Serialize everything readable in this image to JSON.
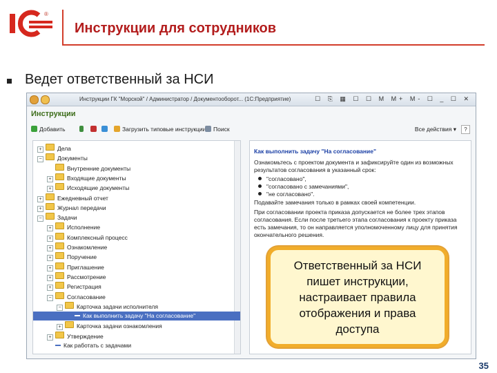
{
  "header": {
    "title": "Инструкции для сотрудников",
    "logo_reg": "®"
  },
  "slide": {
    "bullet_text": "Ведет ответственный за НСИ",
    "page_number": "35"
  },
  "window": {
    "titlebar_text": "Инструкции   ГК \"Морской\" / Администратор / Документооборот...  (1С:Предприятие)",
    "titlebar_icons": "☐ ⎘ ▦ ☐ ☐ M M+ M- ☐ _ ☐ ✕",
    "form_title": "Инструкции",
    "toolbar": {
      "add": "Добавить",
      "load": "Загрузить типовые инструкции",
      "search": "Поиск",
      "all_actions": "Все действия ▾",
      "help": "?"
    },
    "tree": [
      {
        "indent": 0,
        "exp": "+",
        "label": "Дела"
      },
      {
        "indent": 0,
        "exp": "−",
        "label": "Документы"
      },
      {
        "indent": 1,
        "exp": "",
        "label": "Внутренние документы"
      },
      {
        "indent": 1,
        "exp": "+",
        "label": "Входящие документы"
      },
      {
        "indent": 1,
        "exp": "+",
        "label": "Исходящие документы"
      },
      {
        "indent": 0,
        "exp": "+",
        "label": "Ежедневный отчет"
      },
      {
        "indent": 0,
        "exp": "+",
        "label": "Журнал передачи"
      },
      {
        "indent": 0,
        "exp": "−",
        "label": "Задачи"
      },
      {
        "indent": 1,
        "exp": "+",
        "label": "Исполнение"
      },
      {
        "indent": 1,
        "exp": "+",
        "label": "Комплексный процесс"
      },
      {
        "indent": 1,
        "exp": "+",
        "label": "Ознакомление"
      },
      {
        "indent": 1,
        "exp": "+",
        "label": "Поручение"
      },
      {
        "indent": 1,
        "exp": "+",
        "label": "Приглашение"
      },
      {
        "indent": 1,
        "exp": "+",
        "label": "Рассмотрение"
      },
      {
        "indent": 1,
        "exp": "+",
        "label": "Регистрация"
      },
      {
        "indent": 1,
        "exp": "−",
        "label": "Согласование"
      },
      {
        "indent": 2,
        "exp": "−",
        "label": "Карточка задачи исполнителя"
      },
      {
        "indent": 3,
        "exp": "",
        "label": "Как выполнить задачу \"На согласование\"",
        "selected": true,
        "leaf": true
      },
      {
        "indent": 2,
        "exp": "+",
        "label": "Карточка задачи ознакомления"
      },
      {
        "indent": 1,
        "exp": "+",
        "label": "Утверждение"
      },
      {
        "indent": 1,
        "exp": "",
        "label": "Как работать с задачами",
        "leaf": true
      }
    ],
    "doc": {
      "heading": "Как выполнить задачу \"На согласование\"",
      "para1": "Ознакомьтесь с проектом документа и зафиксируйте один из возможных результатов согласования в указанный срок:",
      "bullets": [
        "\"согласовано\",",
        "\"согласовано с замечаниями\",",
        "\"не согласовано\"."
      ],
      "para2": "Подавайте замечания только в рамках своей компетенции.",
      "para3": "При согласовании проекта приказа допускается не более трех этапов согласования. Если после третьего этапа согласования к проекту приказа есть замечания, то он направляется уполномоченному лицу для принятия окончательного решения."
    }
  },
  "callout": {
    "text": "Ответственный за НСИ пишет инструкции, настраивает правила отображения и права доступа"
  }
}
